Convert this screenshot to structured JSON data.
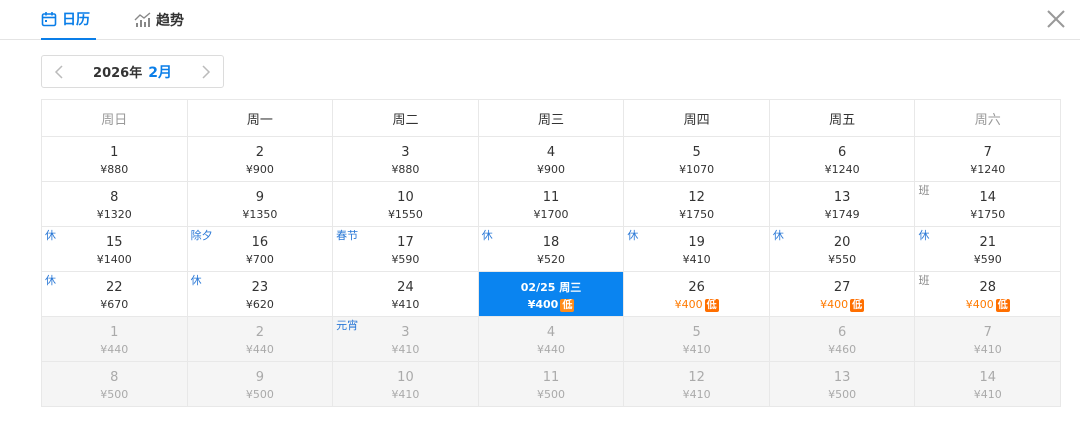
{
  "tabs": [
    {
      "label": "日历",
      "icon": "calendar-icon",
      "active": true
    },
    {
      "label": "趋势",
      "icon": "trend-chart-icon",
      "active": false
    }
  ],
  "month_nav": {
    "year": "2026年",
    "month": "2月"
  },
  "weekdays": [
    "周日",
    "周一",
    "周二",
    "周三",
    "周四",
    "周五",
    "周六"
  ],
  "low_label": "低",
  "colors": {
    "accent": "#0a84f0",
    "low_price": "#ff7a00",
    "holiday_tag": "#2a78d6"
  },
  "weeks": [
    [
      {
        "day": "1",
        "price": "¥880"
      },
      {
        "day": "2",
        "price": "¥900"
      },
      {
        "day": "3",
        "price": "¥880"
      },
      {
        "day": "4",
        "price": "¥900"
      },
      {
        "day": "5",
        "price": "¥1070"
      },
      {
        "day": "6",
        "price": "¥1240"
      },
      {
        "day": "7",
        "price": "¥1240"
      }
    ],
    [
      {
        "day": "8",
        "price": "¥1320"
      },
      {
        "day": "9",
        "price": "¥1350"
      },
      {
        "day": "10",
        "price": "¥1550"
      },
      {
        "day": "11",
        "price": "¥1700"
      },
      {
        "day": "12",
        "price": "¥1750"
      },
      {
        "day": "13",
        "price": "¥1749"
      },
      {
        "day": "14",
        "price": "¥1750",
        "tag": "班"
      }
    ],
    [
      {
        "day": "15",
        "price": "¥1400",
        "tag": "休"
      },
      {
        "day": "16",
        "price": "¥700",
        "tag": "除夕"
      },
      {
        "day": "17",
        "price": "¥590",
        "tag": "春节"
      },
      {
        "day": "18",
        "price": "¥520",
        "tag": "休"
      },
      {
        "day": "19",
        "price": "¥410",
        "tag": "休"
      },
      {
        "day": "20",
        "price": "¥550",
        "tag": "休"
      },
      {
        "day": "21",
        "price": "¥590",
        "tag": "休"
      }
    ],
    [
      {
        "day": "22",
        "price": "¥670",
        "tag": "休"
      },
      {
        "day": "23",
        "price": "¥620",
        "tag": "休"
      },
      {
        "day": "24",
        "price": "¥410"
      },
      {
        "day": "02/25 周三",
        "price": "¥400",
        "low": true,
        "selected": true
      },
      {
        "day": "26",
        "price": "¥400",
        "low": true
      },
      {
        "day": "27",
        "price": "¥400",
        "low": true
      },
      {
        "day": "28",
        "price": "¥400",
        "low": true,
        "tag": "班"
      }
    ],
    [
      {
        "day": "1",
        "price": "¥440",
        "next": true
      },
      {
        "day": "2",
        "price": "¥440",
        "next": true
      },
      {
        "day": "3",
        "price": "¥410",
        "next": true,
        "tag": "元宵"
      },
      {
        "day": "4",
        "price": "¥440",
        "next": true
      },
      {
        "day": "5",
        "price": "¥410",
        "next": true
      },
      {
        "day": "6",
        "price": "¥460",
        "next": true
      },
      {
        "day": "7",
        "price": "¥410",
        "next": true
      }
    ],
    [
      {
        "day": "8",
        "price": "¥500",
        "next": true
      },
      {
        "day": "9",
        "price": "¥500",
        "next": true
      },
      {
        "day": "10",
        "price": "¥410",
        "next": true
      },
      {
        "day": "11",
        "price": "¥500",
        "next": true
      },
      {
        "day": "12",
        "price": "¥410",
        "next": true
      },
      {
        "day": "13",
        "price": "¥500",
        "next": true
      },
      {
        "day": "14",
        "price": "¥410",
        "next": true
      }
    ]
  ]
}
